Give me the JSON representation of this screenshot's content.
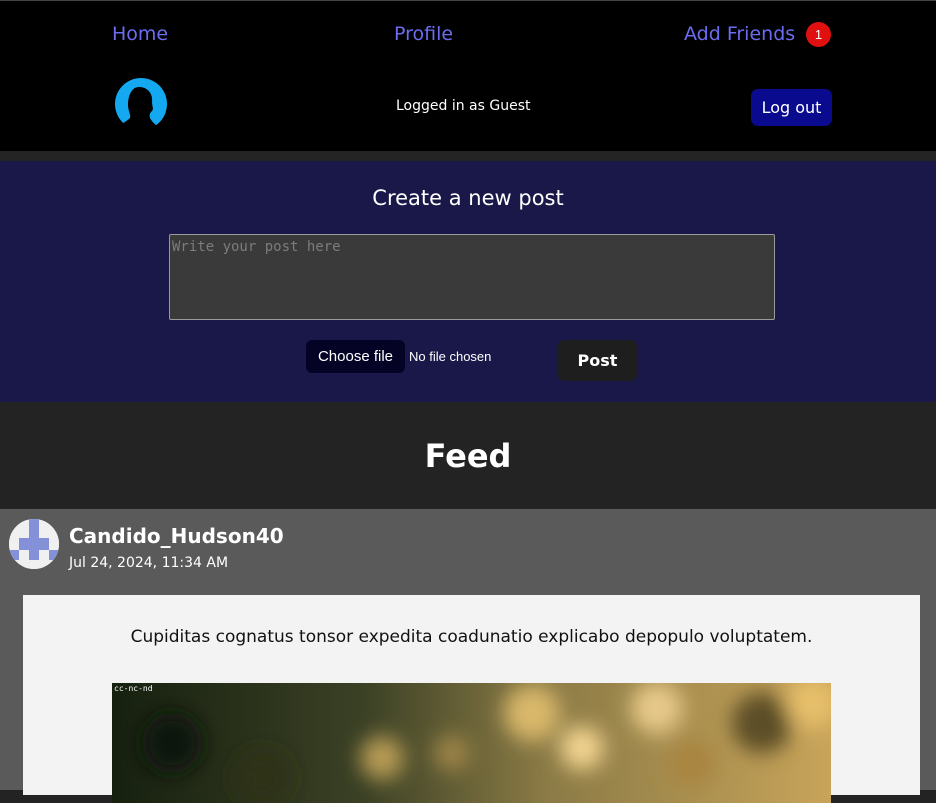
{
  "nav": {
    "home": "Home",
    "profile": "Profile",
    "add_friends": "Add Friends",
    "friend_request_count": "1"
  },
  "header": {
    "logged_in_text": "Logged in as Guest",
    "logout_label": "Log out"
  },
  "create_post": {
    "title": "Create a new post",
    "placeholder": "Write your post here",
    "choose_file_label": "Choose file",
    "file_status": "No file chosen",
    "post_label": "Post"
  },
  "feed": {
    "title": "Feed",
    "posts": [
      {
        "author": "Candido_Hudson40",
        "date": "Jul 24, 2024, 11:34 AM",
        "text": "Cupiditas cognatus tonsor expedita coadunatio explicabo depopulo voluptatem.",
        "image_tag": "cc-nc-nd"
      }
    ]
  },
  "colors": {
    "nav_link": "#6b6cf0",
    "badge": "#e01010",
    "logout_bg": "#0a0a8f",
    "create_bg": "#191848",
    "feed_bg": "#232323",
    "post_card_bg": "#5a5a5a"
  },
  "icons": {
    "default_avatar": "user-silhouette-icon",
    "author_avatar": "identicon"
  }
}
